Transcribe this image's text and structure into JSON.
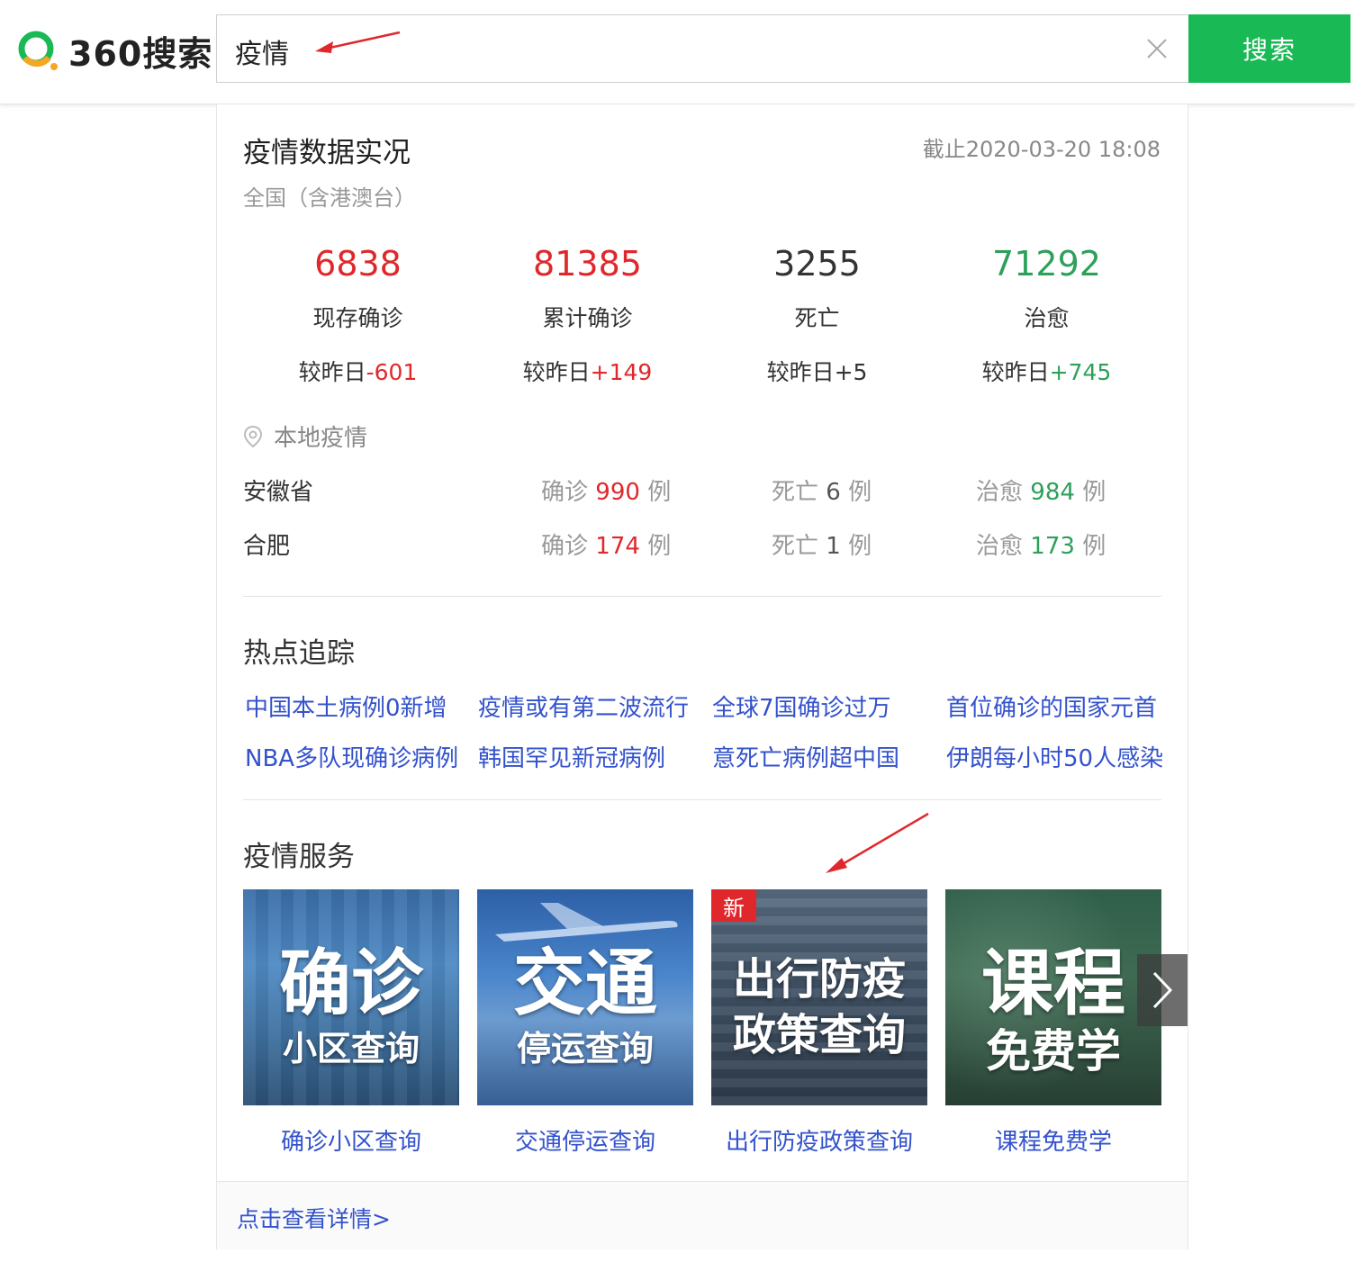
{
  "header": {
    "logo_text": "360搜索",
    "search_value": "疫情",
    "search_button": "搜索",
    "accent": "#19b955"
  },
  "card": {
    "title": "疫情数据实况",
    "update_time": "截止2020-03-20 18:08",
    "scope": "全国（含港澳台）",
    "stats": [
      {
        "value": "6838",
        "label": "现存确诊",
        "delta_prefix": "较昨日",
        "delta": "-601",
        "color": "red"
      },
      {
        "value": "81385",
        "label": "累计确诊",
        "delta_prefix": "较昨日",
        "delta": "+149",
        "color": "red"
      },
      {
        "value": "3255",
        "label": "死亡",
        "delta_prefix": "较昨日",
        "delta": "+5",
        "color": "dark"
      },
      {
        "value": "71292",
        "label": "治愈",
        "delta_prefix": "较昨日",
        "delta": "+745",
        "color": "green"
      }
    ],
    "local": {
      "title": "本地疫情",
      "rows": [
        {
          "name": "安徽省",
          "confirmed_label": "确诊",
          "confirmed": "990",
          "death_label": "死亡",
          "death": "6",
          "cured_label": "治愈",
          "cured": "984",
          "unit": "例"
        },
        {
          "name": "合肥",
          "confirmed_label": "确诊",
          "confirmed": "174",
          "death_label": "死亡",
          "death": "1",
          "cured_label": "治愈",
          "cured": "173",
          "unit": "例"
        }
      ]
    },
    "hot": {
      "title": "热点追踪",
      "links": [
        "中国本土病例0新增",
        "疫情或有第二波流行",
        "全球7国确诊过万",
        "首位确诊的国家元首",
        "NBA多队现确诊病例",
        "韩国罕见新冠病例",
        "意死亡病例超中国",
        "伊朗每小时50人感染"
      ]
    },
    "services": {
      "title": "疫情服务",
      "items": [
        {
          "big": "确诊",
          "small": "小区查询",
          "caption": "确诊小区查询"
        },
        {
          "big": "交通",
          "small": "停运查询",
          "caption": "交通停运查询"
        },
        {
          "big": "出行防疫",
          "small": "政策查询",
          "caption": "出行防疫政策查询",
          "badge": "新"
        },
        {
          "big": "课程",
          "small": "免费学",
          "caption": "课程免费学"
        }
      ]
    },
    "footer_link": "点击查看详情>"
  }
}
